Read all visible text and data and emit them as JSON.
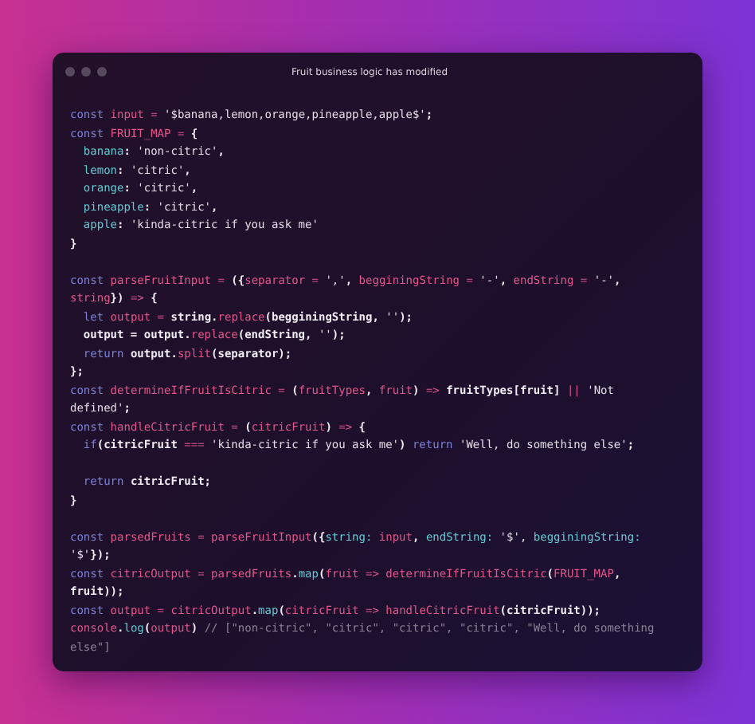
{
  "window": {
    "title": "Fruit business logic has modified"
  },
  "code_blocks": [
    {
      "lines": [
        {
          "tokens": [
            {
              "text": "const ",
              "kind": "k"
            },
            {
              "text": "input",
              "kind": "v"
            },
            {
              "text": " = ",
              "kind": "o"
            },
            {
              "text": "'$banana,lemon,orange,pineapple,apple$'",
              "kind": "s"
            },
            {
              "text": ";",
              "kind": "t"
            }
          ]
        },
        {
          "tokens": [
            {
              "text": "const ",
              "kind": "k"
            },
            {
              "text": "FRUIT_MAP",
              "kind": "v"
            },
            {
              "text": " = ",
              "kind": "o"
            },
            {
              "text": "{",
              "kind": "t"
            }
          ]
        },
        {
          "tokens": [
            {
              "text": "  banana",
              "kind": "p"
            },
            {
              "text": ": ",
              "kind": "t"
            },
            {
              "text": "'non-citric'",
              "kind": "s"
            },
            {
              "text": ",",
              "kind": "t"
            }
          ]
        },
        {
          "tokens": [
            {
              "text": "  lemon",
              "kind": "p"
            },
            {
              "text": ": ",
              "kind": "t"
            },
            {
              "text": "'citric'",
              "kind": "s"
            },
            {
              "text": ",",
              "kind": "t"
            }
          ]
        },
        {
          "tokens": [
            {
              "text": "  orange",
              "kind": "p"
            },
            {
              "text": ": ",
              "kind": "t"
            },
            {
              "text": "'citric'",
              "kind": "s"
            },
            {
              "text": ",",
              "kind": "t"
            }
          ]
        },
        {
          "tokens": [
            {
              "text": "  pineapple",
              "kind": "p"
            },
            {
              "text": ": ",
              "kind": "t"
            },
            {
              "text": "'citric'",
              "kind": "s"
            },
            {
              "text": ",",
              "kind": "t"
            }
          ]
        },
        {
          "tokens": [
            {
              "text": "  apple",
              "kind": "p"
            },
            {
              "text": ": ",
              "kind": "t"
            },
            {
              "text": "'kinda-citric if you ask me'",
              "kind": "s"
            }
          ]
        },
        {
          "tokens": [
            {
              "text": "}",
              "kind": "t"
            }
          ]
        }
      ]
    },
    {
      "lines": [
        {
          "tokens": [
            {
              "text": "const ",
              "kind": "k"
            },
            {
              "text": "parseFruitInput",
              "kind": "v"
            },
            {
              "text": " = ",
              "kind": "o"
            },
            {
              "text": "({",
              "kind": "t"
            },
            {
              "text": "separator",
              "kind": "v"
            },
            {
              "text": " = ",
              "kind": "o"
            },
            {
              "text": "','",
              "kind": "s"
            },
            {
              "text": ", ",
              "kind": "t"
            },
            {
              "text": "begginingString",
              "kind": "v"
            },
            {
              "text": " = ",
              "kind": "o"
            },
            {
              "text": "'-'",
              "kind": "s"
            },
            {
              "text": ", ",
              "kind": "t"
            },
            {
              "text": "endString",
              "kind": "v"
            },
            {
              "text": " = ",
              "kind": "o"
            },
            {
              "text": "'-'",
              "kind": "s"
            },
            {
              "text": ",",
              "kind": "t"
            }
          ]
        },
        {
          "tokens": [
            {
              "text": "string",
              "kind": "v"
            },
            {
              "text": "}) ",
              "kind": "t"
            },
            {
              "text": "=> ",
              "kind": "o"
            },
            {
              "text": "{",
              "kind": "t"
            }
          ]
        },
        {
          "tokens": [
            {
              "text": "  let ",
              "kind": "k"
            },
            {
              "text": "output",
              "kind": "v"
            },
            {
              "text": " = ",
              "kind": "o"
            },
            {
              "text": "string.",
              "kind": "t"
            },
            {
              "text": "replace",
              "kind": "v"
            },
            {
              "text": "(begginingString, ",
              "kind": "t"
            },
            {
              "text": "''",
              "kind": "s"
            },
            {
              "text": ");",
              "kind": "t"
            }
          ]
        },
        {
          "tokens": [
            {
              "text": "  output = output.",
              "kind": "t"
            },
            {
              "text": "replace",
              "kind": "v"
            },
            {
              "text": "(endString, ",
              "kind": "t"
            },
            {
              "text": "''",
              "kind": "s"
            },
            {
              "text": ");",
              "kind": "t"
            }
          ]
        },
        {
          "tokens": [
            {
              "text": "  return ",
              "kind": "k"
            },
            {
              "text": "output.",
              "kind": "t"
            },
            {
              "text": "split",
              "kind": "v"
            },
            {
              "text": "(separator);",
              "kind": "t"
            }
          ]
        },
        {
          "tokens": [
            {
              "text": "};",
              "kind": "t"
            }
          ]
        },
        {
          "tokens": [
            {
              "text": "const ",
              "kind": "k"
            },
            {
              "text": "determineIfFruitIsCitric",
              "kind": "v"
            },
            {
              "text": " = ",
              "kind": "o"
            },
            {
              "text": "(",
              "kind": "t"
            },
            {
              "text": "fruitTypes",
              "kind": "v"
            },
            {
              "text": ", ",
              "kind": "t"
            },
            {
              "text": "fruit",
              "kind": "v"
            },
            {
              "text": ") ",
              "kind": "t"
            },
            {
              "text": "=> ",
              "kind": "o"
            },
            {
              "text": "fruitTypes[fruit] ",
              "kind": "t"
            },
            {
              "text": "|| ",
              "kind": "o"
            },
            {
              "text": "'Not",
              "kind": "s"
            }
          ]
        },
        {
          "tokens": [
            {
              "text": "defined'",
              "kind": "s"
            },
            {
              "text": ";",
              "kind": "t"
            }
          ]
        },
        {
          "tokens": [
            {
              "text": "const ",
              "kind": "k"
            },
            {
              "text": "handleCitricFruit",
              "kind": "v"
            },
            {
              "text": " = ",
              "kind": "o"
            },
            {
              "text": "(",
              "kind": "t"
            },
            {
              "text": "citricFruit",
              "kind": "v"
            },
            {
              "text": ") ",
              "kind": "t"
            },
            {
              "text": "=> ",
              "kind": "o"
            },
            {
              "text": "{",
              "kind": "t"
            }
          ]
        },
        {
          "tokens": [
            {
              "text": "  if",
              "kind": "k"
            },
            {
              "text": "(citricFruit ",
              "kind": "t"
            },
            {
              "text": "=== ",
              "kind": "o"
            },
            {
              "text": "'kinda-citric if you ask me'",
              "kind": "s"
            },
            {
              "text": ") ",
              "kind": "t"
            },
            {
              "text": "return ",
              "kind": "k"
            },
            {
              "text": "'Well, do something else'",
              "kind": "s"
            },
            {
              "text": ";",
              "kind": "t"
            }
          ]
        }
      ]
    },
    {
      "lines": [
        {
          "tokens": [
            {
              "text": "  return ",
              "kind": "k"
            },
            {
              "text": "citricFruit;",
              "kind": "t"
            }
          ]
        },
        {
          "tokens": [
            {
              "text": "}",
              "kind": "t"
            }
          ]
        }
      ]
    },
    {
      "lines": [
        {
          "tokens": [
            {
              "text": "const ",
              "kind": "k"
            },
            {
              "text": "parsedFruits",
              "kind": "v"
            },
            {
              "text": " = ",
              "kind": "o"
            },
            {
              "text": "parseFruitInput",
              "kind": "v"
            },
            {
              "text": "({",
              "kind": "t"
            },
            {
              "text": "string:",
              "kind": "p"
            },
            {
              "text": " input",
              "kind": "v"
            },
            {
              "text": ", ",
              "kind": "t"
            },
            {
              "text": "endString:",
              "kind": "p"
            },
            {
              "text": " '$', ",
              "kind": "s"
            },
            {
              "text": "begginingString:",
              "kind": "p"
            }
          ]
        },
        {
          "tokens": [
            {
              "text": "'$'",
              "kind": "s"
            },
            {
              "text": "});",
              "kind": "t"
            }
          ]
        },
        {
          "tokens": [
            {
              "text": "const ",
              "kind": "k"
            },
            {
              "text": "citricOutput",
              "kind": "v"
            },
            {
              "text": " = ",
              "kind": "o"
            },
            {
              "text": "parsedFruits",
              "kind": "v"
            },
            {
              "text": ".",
              "kind": "t"
            },
            {
              "text": "map",
              "kind": "p"
            },
            {
              "text": "(",
              "kind": "t"
            },
            {
              "text": "fruit",
              "kind": "v"
            },
            {
              "text": " => ",
              "kind": "o"
            },
            {
              "text": "determineIfFruitIsCitric",
              "kind": "v"
            },
            {
              "text": "(",
              "kind": "t"
            },
            {
              "text": "FRUIT_MAP",
              "kind": "v"
            },
            {
              "text": ",",
              "kind": "t"
            }
          ]
        },
        {
          "tokens": [
            {
              "text": "fruit));",
              "kind": "t"
            }
          ]
        },
        {
          "tokens": [
            {
              "text": "const ",
              "kind": "k"
            },
            {
              "text": "output",
              "kind": "v"
            },
            {
              "text": " = ",
              "kind": "o"
            },
            {
              "text": "citricOutput",
              "kind": "v"
            },
            {
              "text": ".",
              "kind": "t"
            },
            {
              "text": "map",
              "kind": "p"
            },
            {
              "text": "(",
              "kind": "t"
            },
            {
              "text": "citricFruit",
              "kind": "v"
            },
            {
              "text": " => ",
              "kind": "o"
            },
            {
              "text": "handleCitricFruit",
              "kind": "v"
            },
            {
              "text": "(citricFruit));",
              "kind": "t"
            }
          ]
        },
        {
          "tokens": [
            {
              "text": "console",
              "kind": "v"
            },
            {
              "text": ".",
              "kind": "t"
            },
            {
              "text": "log",
              "kind": "p"
            },
            {
              "text": "(",
              "kind": "t"
            },
            {
              "text": "output",
              "kind": "v"
            },
            {
              "text": ") ",
              "kind": "t"
            },
            {
              "text": "// [\"non-citric\", \"citric\", \"citric\", \"citric\", \"Well, do something",
              "kind": "c"
            }
          ]
        },
        {
          "tokens": [
            {
              "text": "else\"]",
              "kind": "c"
            }
          ]
        }
      ]
    }
  ]
}
